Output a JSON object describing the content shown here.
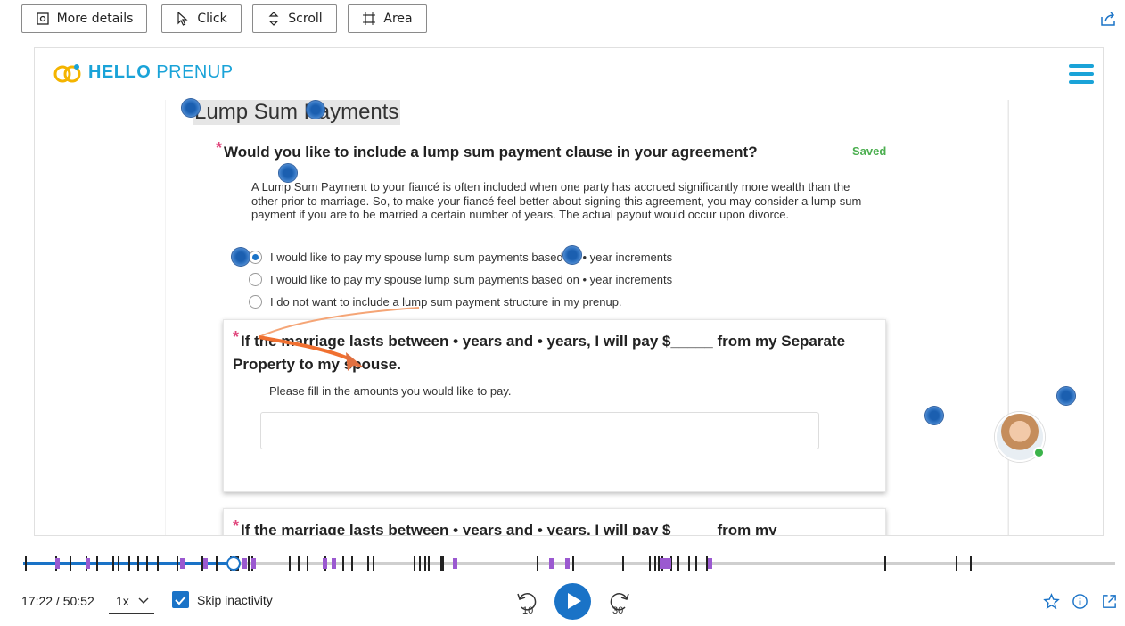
{
  "toolbar": {
    "more_details": "More details",
    "click": "Click",
    "scroll": "Scroll",
    "area": "Area",
    "share_icon": "share-icon"
  },
  "site": {
    "logo_bold": "HELLO",
    "logo_regular": "PRENUP",
    "section_title": "Lump Sum Payments",
    "saved": "Saved",
    "question1": "Would you like to include a lump sum payment clause in your agreement?",
    "question1_desc": "A Lump Sum Payment to your fiancé is often included when one party has accrued significantly more wealth than the other prior to marriage. So, to make your fiancé feel better about signing this agreement, you may consider a lump sum payment if you are to be married a certain number of years. The actual payout would occur upon divorce.",
    "options": [
      {
        "label": "I would like to pay my spouse lump sum payments based on • year increments",
        "selected": true
      },
      {
        "label": "I would like to pay my spouse lump sum payments based on • year increments",
        "selected": false
      },
      {
        "label": "I do not want to include a lump sum payment structure in my prenup.",
        "selected": false
      }
    ],
    "card1_question": "If the marriage lasts between • years and • years, I will pay $_____ from my Separate Property to my spouse.",
    "card1_hint": "Please fill in the amounts you would like to pay.",
    "card2_question": "If the marriage lasts between • years and • years, I will pay $_____ from my"
  },
  "player": {
    "time": "17:22 / 50:52",
    "speed": "1x",
    "skip_inactivity": "Skip inactivity",
    "skip_back": "10",
    "skip_forward": "30",
    "progress": 0.193
  },
  "colors": {
    "brand": "#1aa3d8",
    "accent": "#1a73c7",
    "required": "#e0457b",
    "saved": "#4caf50"
  }
}
